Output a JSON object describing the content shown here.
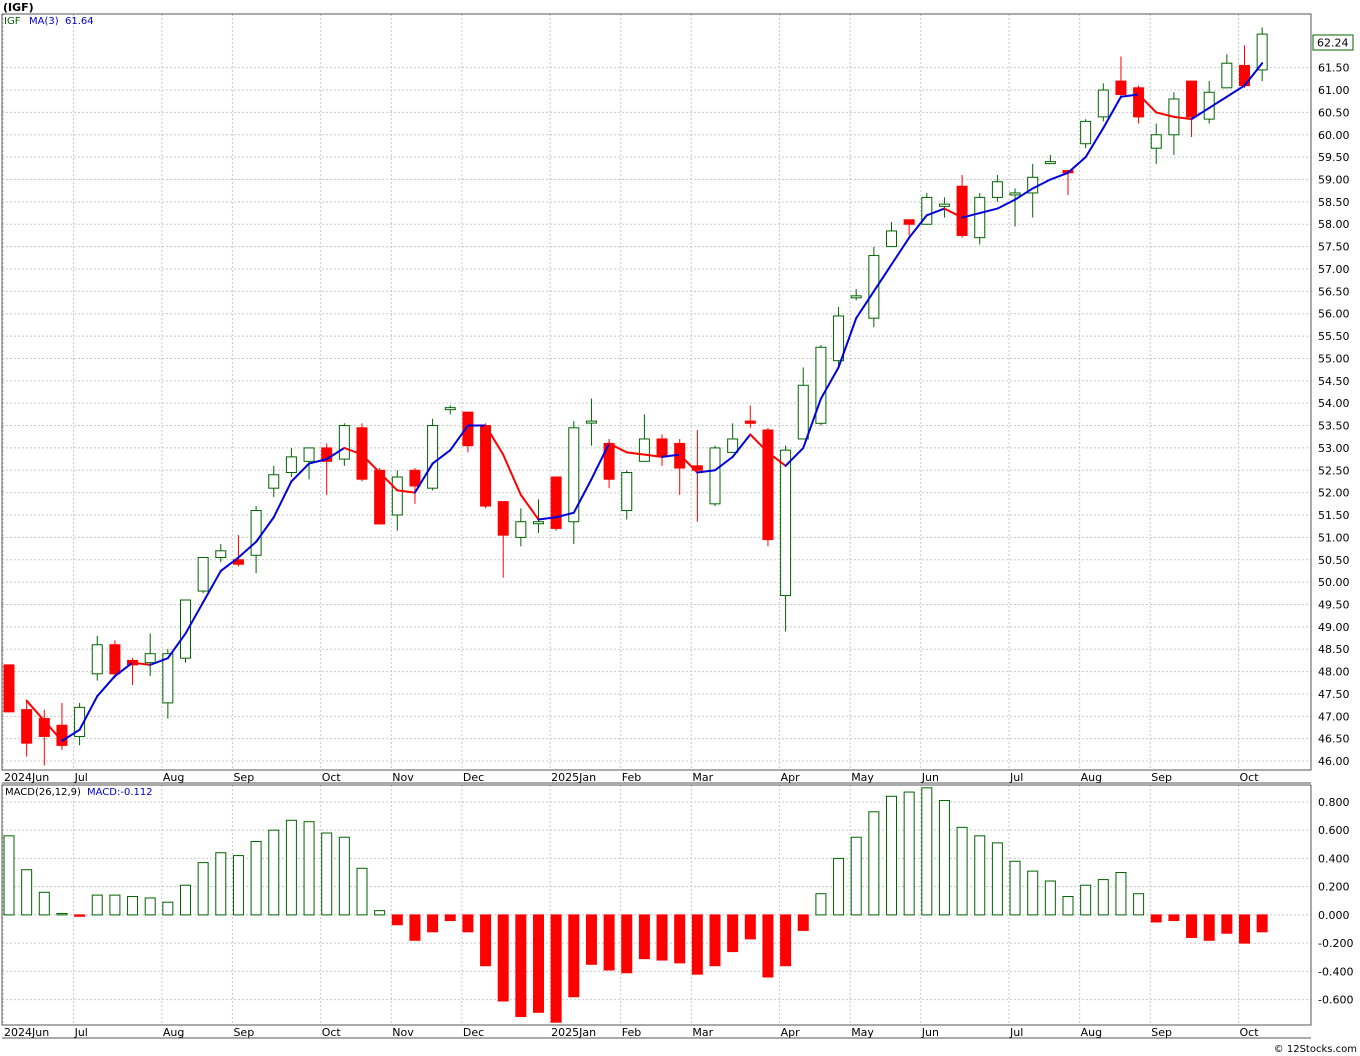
{
  "header": {
    "symbol": "(IGF)",
    "watermark": "© 12Stocks.com"
  },
  "price_panel": {
    "ticker_label": "IGF",
    "ma_label": "MA(3)",
    "ma_value": "61.64",
    "last_price_tag": "62.24",
    "colors": {
      "up": "#006400",
      "down": "#ff0000",
      "ma_up": "#0000dd",
      "ma_down": "#ff0000",
      "tag_border": "#006400"
    }
  },
  "macd_panel": {
    "indicator_label": "MACD(26,12,9)",
    "value_label": "MACD:-0.112",
    "colors": {
      "positive": "#006400",
      "negative": "#ff0000"
    }
  },
  "chart_data": [
    {
      "type": "candlestick",
      "title": "(IGF)",
      "ylim": [
        45.8,
        62.7
      ],
      "y_ticks": [
        "46.00",
        "46.50",
        "47.00",
        "47.50",
        "48.00",
        "48.50",
        "49.00",
        "49.50",
        "50.00",
        "50.50",
        "51.00",
        "51.50",
        "52.00",
        "52.50",
        "53.00",
        "53.50",
        "54.00",
        "54.50",
        "55.00",
        "55.50",
        "56.00",
        "56.50",
        "57.00",
        "57.50",
        "58.00",
        "58.50",
        "59.00",
        "59.50",
        "60.00",
        "60.50",
        "61.00",
        "61.50"
      ],
      "x_labels": [
        {
          "label": "2024Jun",
          "week": 0
        },
        {
          "label": "Jul",
          "week": 4
        },
        {
          "label": "Aug",
          "week": 9
        },
        {
          "label": "Sep",
          "week": 13
        },
        {
          "label": "Oct",
          "week": 18
        },
        {
          "label": "Nov",
          "week": 22
        },
        {
          "label": "Dec",
          "week": 26
        },
        {
          "label": "2025Jan",
          "week": 31
        },
        {
          "label": "Feb",
          "week": 35
        },
        {
          "label": "Mar",
          "week": 39
        },
        {
          "label": "Apr",
          "week": 44
        },
        {
          "label": "May",
          "week": 48
        },
        {
          "label": "Jun",
          "week": 52
        },
        {
          "label": "Jul",
          "week": 57
        },
        {
          "label": "Aug",
          "week": 61
        },
        {
          "label": "Sep",
          "week": 65
        },
        {
          "label": "Oct",
          "week": 70
        }
      ],
      "candles": [
        [
          48.15,
          47.1,
          48.15,
          47.1
        ],
        [
          47.15,
          46.4,
          47.35,
          46.1
        ],
        [
          46.95,
          46.55,
          47.15,
          45.9
        ],
        [
          46.8,
          46.35,
          47.3,
          46.25
        ],
        [
          46.55,
          47.2,
          47.3,
          46.35
        ],
        [
          47.95,
          48.6,
          48.8,
          47.8
        ],
        [
          48.6,
          47.95,
          48.7,
          47.85
        ],
        [
          48.25,
          48.15,
          48.3,
          47.7
        ],
        [
          48.2,
          48.4,
          48.85,
          47.9
        ],
        [
          47.3,
          48.4,
          48.5,
          46.95
        ],
        [
          48.3,
          49.6,
          49.6,
          48.2
        ],
        [
          49.8,
          50.55,
          50.55,
          49.75
        ],
        [
          50.55,
          50.7,
          50.85,
          50.45
        ],
        [
          50.5,
          50.4,
          51.05,
          50.35
        ],
        [
          50.6,
          51.6,
          51.7,
          50.2
        ],
        [
          52.1,
          52.4,
          52.6,
          51.9
        ],
        [
          52.45,
          52.8,
          53.0,
          52.35
        ],
        [
          52.7,
          53.0,
          53.0,
          52.3
        ],
        [
          53.0,
          52.7,
          53.1,
          51.95
        ],
        [
          52.75,
          53.5,
          53.55,
          52.6
        ],
        [
          53.45,
          52.3,
          53.55,
          52.25
        ],
        [
          52.5,
          51.3,
          52.55,
          51.3
        ],
        [
          51.5,
          52.35,
          52.5,
          51.15
        ],
        [
          52.5,
          52.15,
          52.55,
          51.75
        ],
        [
          52.1,
          53.5,
          53.65,
          52.05
        ],
        [
          53.9,
          53.9,
          53.95,
          53.75
        ],
        [
          53.8,
          53.05,
          53.8,
          52.9
        ],
        [
          53.5,
          51.7,
          53.55,
          51.65
        ],
        [
          51.8,
          51.05,
          51.8,
          50.1
        ],
        [
          51.0,
          51.35,
          51.65,
          50.8
        ],
        [
          51.35,
          51.35,
          51.85,
          51.1
        ],
        [
          52.35,
          51.2,
          52.35,
          51.15
        ],
        [
          51.35,
          53.45,
          53.6,
          50.85
        ],
        [
          53.6,
          53.6,
          54.1,
          53.05
        ],
        [
          53.1,
          52.3,
          53.2,
          52.1
        ],
        [
          51.6,
          52.45,
          52.5,
          51.4
        ],
        [
          52.7,
          53.2,
          53.75,
          52.7
        ],
        [
          53.2,
          52.8,
          53.3,
          52.6
        ],
        [
          53.1,
          52.55,
          53.2,
          51.95
        ],
        [
          52.6,
          52.5,
          53.4,
          51.35
        ],
        [
          51.75,
          53.0,
          53.05,
          51.7
        ],
        [
          52.9,
          53.2,
          53.55,
          52.9
        ],
        [
          53.6,
          53.55,
          53.95,
          53.45
        ],
        [
          53.4,
          50.95,
          53.45,
          50.8
        ],
        [
          49.7,
          52.95,
          53.05,
          48.9
        ],
        [
          53.2,
          54.4,
          54.8,
          53.2
        ],
        [
          53.55,
          55.25,
          55.3,
          53.5
        ],
        [
          54.95,
          55.95,
          56.15,
          54.8
        ],
        [
          56.4,
          56.4,
          56.55,
          56.3
        ],
        [
          55.9,
          57.3,
          57.5,
          55.7
        ],
        [
          57.5,
          57.85,
          58.05,
          57.5
        ],
        [
          58.1,
          58.0,
          58.1,
          57.75
        ],
        [
          58.0,
          58.6,
          58.7,
          58.0
        ],
        [
          58.4,
          58.45,
          58.6,
          58.15
        ],
        [
          58.85,
          57.75,
          59.1,
          57.7
        ],
        [
          57.7,
          58.6,
          58.7,
          57.55
        ],
        [
          58.6,
          58.95,
          59.1,
          58.5
        ],
        [
          58.7,
          58.7,
          58.8,
          57.95
        ],
        [
          58.7,
          59.05,
          59.35,
          58.15
        ],
        [
          59.4,
          59.4,
          59.55,
          59.35
        ],
        [
          59.2,
          59.15,
          59.2,
          58.65
        ],
        [
          59.8,
          60.3,
          60.35,
          59.7
        ],
        [
          60.4,
          61.0,
          61.15,
          60.3
        ],
        [
          61.2,
          60.9,
          61.75,
          60.85
        ],
        [
          61.05,
          60.4,
          61.1,
          60.25
        ],
        [
          59.7,
          60.0,
          60.25,
          59.35
        ],
        [
          60.0,
          60.8,
          60.95,
          59.55
        ],
        [
          61.2,
          60.4,
          61.2,
          59.95
        ],
        [
          60.35,
          60.95,
          61.2,
          60.25
        ],
        [
          61.05,
          61.6,
          61.8,
          61.05
        ],
        [
          61.55,
          61.1,
          62.0,
          61.05
        ],
        [
          61.45,
          62.25,
          62.4,
          61.2
        ]
      ],
      "ma3": [
        47.35,
        46.9,
        46.45,
        46.7,
        47.45,
        47.9,
        48.2,
        48.15,
        48.3,
        48.85,
        49.55,
        50.25,
        50.55,
        50.9,
        51.45,
        52.25,
        52.65,
        52.75,
        53.0,
        52.85,
        52.45,
        52.05,
        52.0,
        52.65,
        52.95,
        53.5,
        53.5,
        52.85,
        51.95,
        51.4,
        51.45,
        51.55,
        52.3,
        53.1,
        52.9,
        52.85,
        52.8,
        52.85,
        52.45,
        52.5,
        52.8,
        53.3,
        52.9,
        52.6,
        53.0,
        54.1,
        54.8,
        55.9,
        56.5,
        57.1,
        57.7,
        58.2,
        58.35,
        58.15,
        58.25,
        58.35,
        58.55,
        58.8,
        59.0,
        59.15,
        59.5,
        60.15,
        60.85,
        60.9,
        60.5,
        60.4,
        60.35,
        60.6,
        60.85,
        61.1,
        61.6
      ],
      "ma3_start_week": 1
    },
    {
      "type": "bar",
      "title": "MACD(26,12,9)",
      "ylim": [
        -0.78,
        0.92
      ],
      "y_ticks": [
        "-0.600",
        "-0.400",
        "-0.200",
        "0.000",
        "0.200",
        "0.400",
        "0.600",
        "0.800"
      ],
      "values": [
        0.56,
        0.32,
        0.16,
        0.01,
        -0.01,
        0.14,
        0.14,
        0.13,
        0.12,
        0.09,
        0.21,
        0.37,
        0.44,
        0.42,
        0.52,
        0.6,
        0.67,
        0.66,
        0.58,
        0.55,
        0.33,
        0.03,
        -0.07,
        -0.18,
        -0.12,
        -0.04,
        -0.12,
        -0.36,
        -0.61,
        -0.72,
        -0.69,
        -0.76,
        -0.58,
        -0.35,
        -0.39,
        -0.41,
        -0.31,
        -0.32,
        -0.34,
        -0.42,
        -0.36,
        -0.26,
        -0.17,
        -0.44,
        -0.36,
        -0.11,
        0.15,
        0.4,
        0.55,
        0.73,
        0.84,
        0.87,
        0.9,
        0.81,
        0.62,
        0.56,
        0.51,
        0.38,
        0.31,
        0.24,
        0.13,
        0.21,
        0.25,
        0.3,
        0.15,
        -0.05,
        -0.04,
        -0.16,
        -0.18,
        -0.13,
        -0.2,
        -0.12
      ]
    }
  ]
}
